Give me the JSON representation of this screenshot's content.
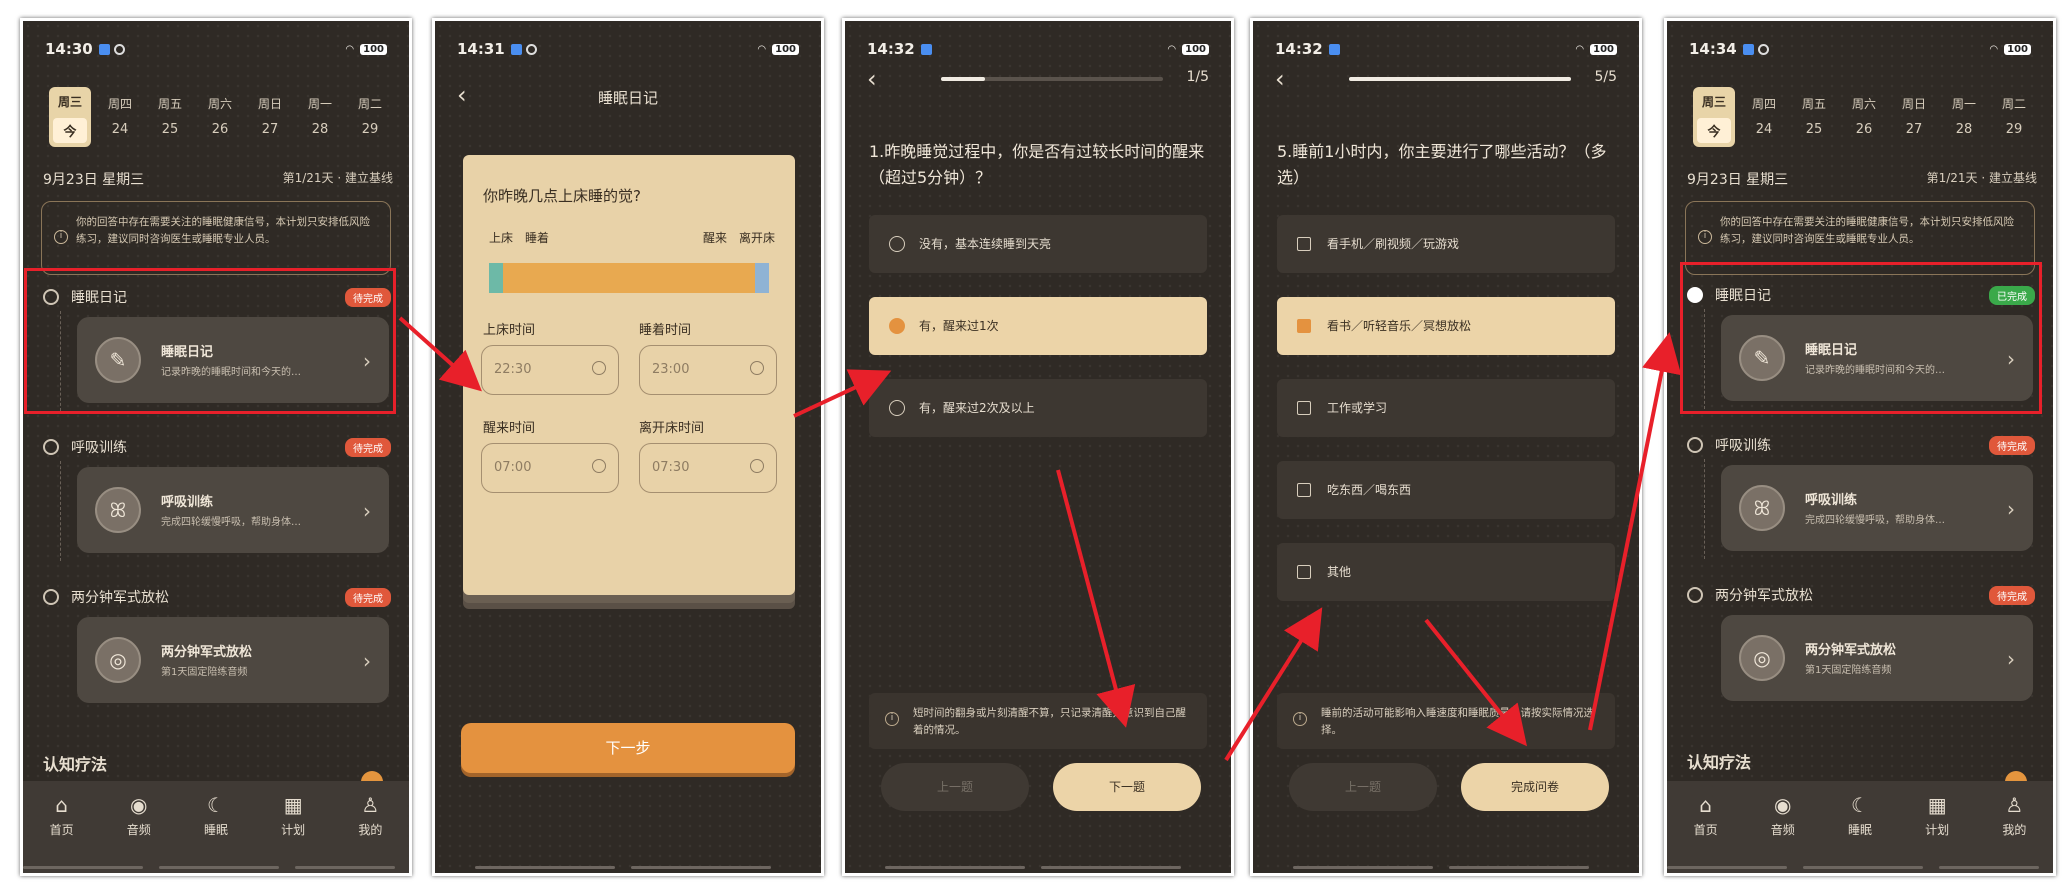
{
  "status": {
    "p1": "14:30",
    "p2": "14:31",
    "p3": "14:32",
    "p4": "14:32",
    "p5": "14:34",
    "battery": "100"
  },
  "calendar": {
    "today_top": "周三",
    "today_bottom": "今",
    "days": [
      {
        "w": "周四",
        "d": "24"
      },
      {
        "w": "周五",
        "d": "25"
      },
      {
        "w": "周六",
        "d": "26"
      },
      {
        "w": "周日",
        "d": "27"
      },
      {
        "w": "周一",
        "d": "28"
      },
      {
        "w": "周二",
        "d": "29"
      }
    ]
  },
  "home": {
    "date": "9月23日 星期三",
    "progress": "第1/21天 · 建立基线",
    "notice": "你的回答中存在需要关注的睡眠健康信号，本计划只安排低风险练习，建议同时咨询医生或睡眠专业人员。",
    "tasks": [
      {
        "title": "睡眠日记",
        "status": "待完成",
        "status_done": "已完成",
        "card_title": "睡眠日记",
        "card_sub": "记录昨晚的睡眠时间和今天的…"
      },
      {
        "title": "呼吸训练",
        "status": "待完成",
        "card_title": "呼吸训练",
        "card_sub": "完成四轮缓慢呼吸，帮助身体…"
      },
      {
        "title": "两分钟军式放松",
        "status": "待完成",
        "card_title": "两分钟军式放松",
        "card_sub": "第1天固定陪练音频"
      }
    ],
    "section": "认知疗法",
    "nav": [
      "首页",
      "音频",
      "睡眠",
      "计划",
      "我的"
    ]
  },
  "diary": {
    "title": "睡眠日记",
    "question": "你昨晚几点上床睡的觉?",
    "bar_labels": [
      "上床",
      "睡着",
      "醒来",
      "离开床"
    ],
    "fields": [
      {
        "label": "上床时间",
        "value": "22:30"
      },
      {
        "label": "睡着时间",
        "value": "23:00"
      },
      {
        "label": "醒来时间",
        "value": "07:00"
      },
      {
        "label": "离开床时间",
        "value": "07:30"
      }
    ],
    "next": "下一步"
  },
  "q1": {
    "count": "1/5",
    "progress": 0.2,
    "question": "1.昨晚睡觉过程中，你是否有过较长时间的醒来（超过5分钟）？",
    "options": [
      "没有，基本连续睡到天亮",
      "有，醒来过1次",
      "有，醒来过2次及以上"
    ],
    "selected": 1,
    "tip": "短时间的翻身或片刻清醒不算，只记录清醒并意识到自己醒着的情况。",
    "prev": "上一题",
    "next": "下一题"
  },
  "q5": {
    "count": "5/5",
    "progress": 1.0,
    "question": "5.睡前1小时内，你主要进行了哪些活动？（多选）",
    "options": [
      "看手机／刷视频／玩游戏",
      "看书／听轻音乐／冥想放松",
      "工作或学习",
      "吃东西／喝东西",
      "其他"
    ],
    "selected": 1,
    "tip": "睡前的活动可能影响入睡速度和睡眠质量，请按实际情况选择。",
    "prev": "上一题",
    "next": "完成问卷"
  }
}
